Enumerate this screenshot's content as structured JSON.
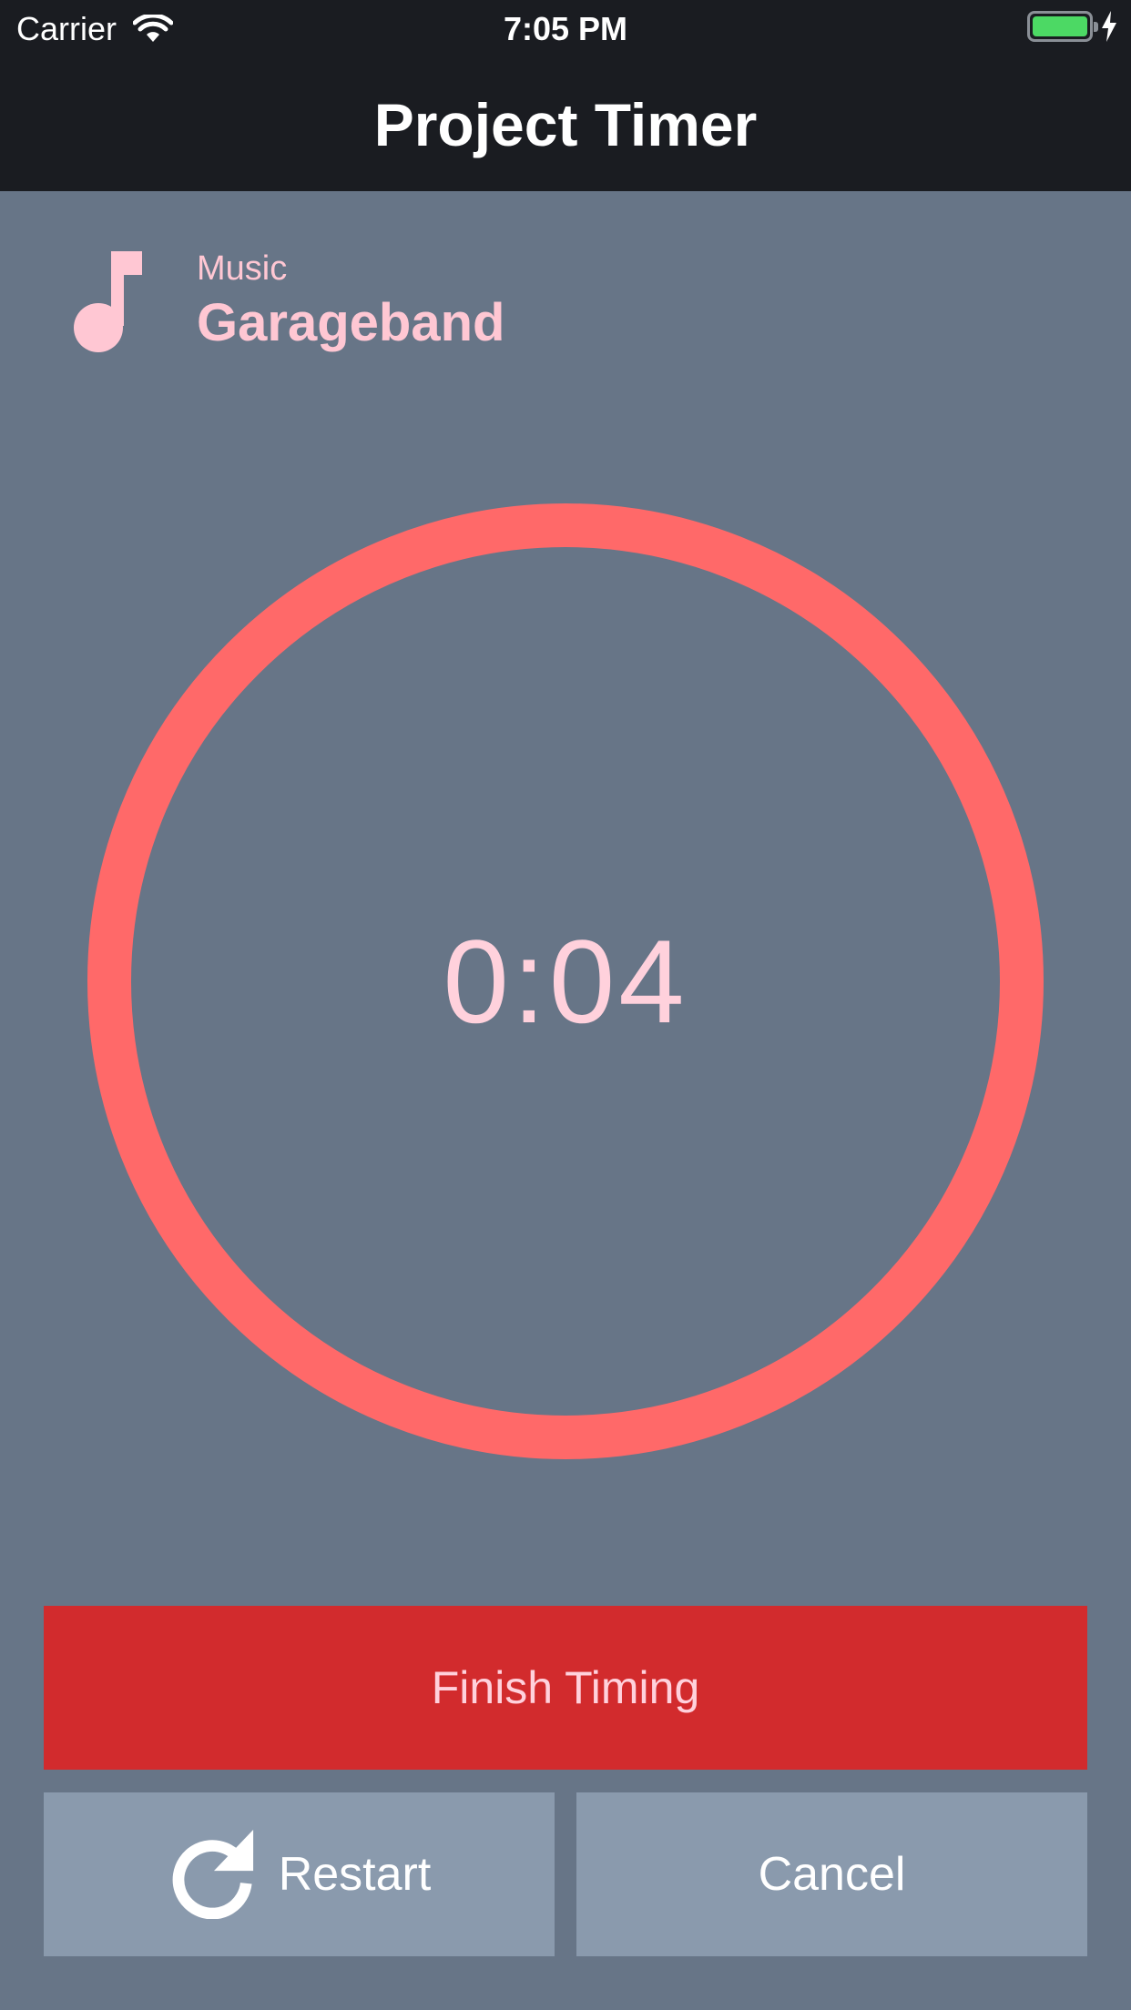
{
  "status_bar": {
    "carrier": "Carrier",
    "time": "7:05 PM",
    "battery_color": "#4cd964"
  },
  "nav": {
    "title": "Project Timer"
  },
  "project": {
    "icon": "music-note-icon",
    "category": "Music",
    "name": "Garageband"
  },
  "timer": {
    "elapsed": "0:04",
    "ring_color": "#ff6969"
  },
  "actions": {
    "finish_label": "Finish Timing",
    "restart_label": "Restart",
    "restart_icon": "restart-icon",
    "cancel_label": "Cancel"
  },
  "colors": {
    "background": "#677587",
    "bar": "#1a1c21",
    "accent_text": "#ffc7d3",
    "finish_button": "#d22b2d",
    "secondary_button": "#8a9aad"
  }
}
